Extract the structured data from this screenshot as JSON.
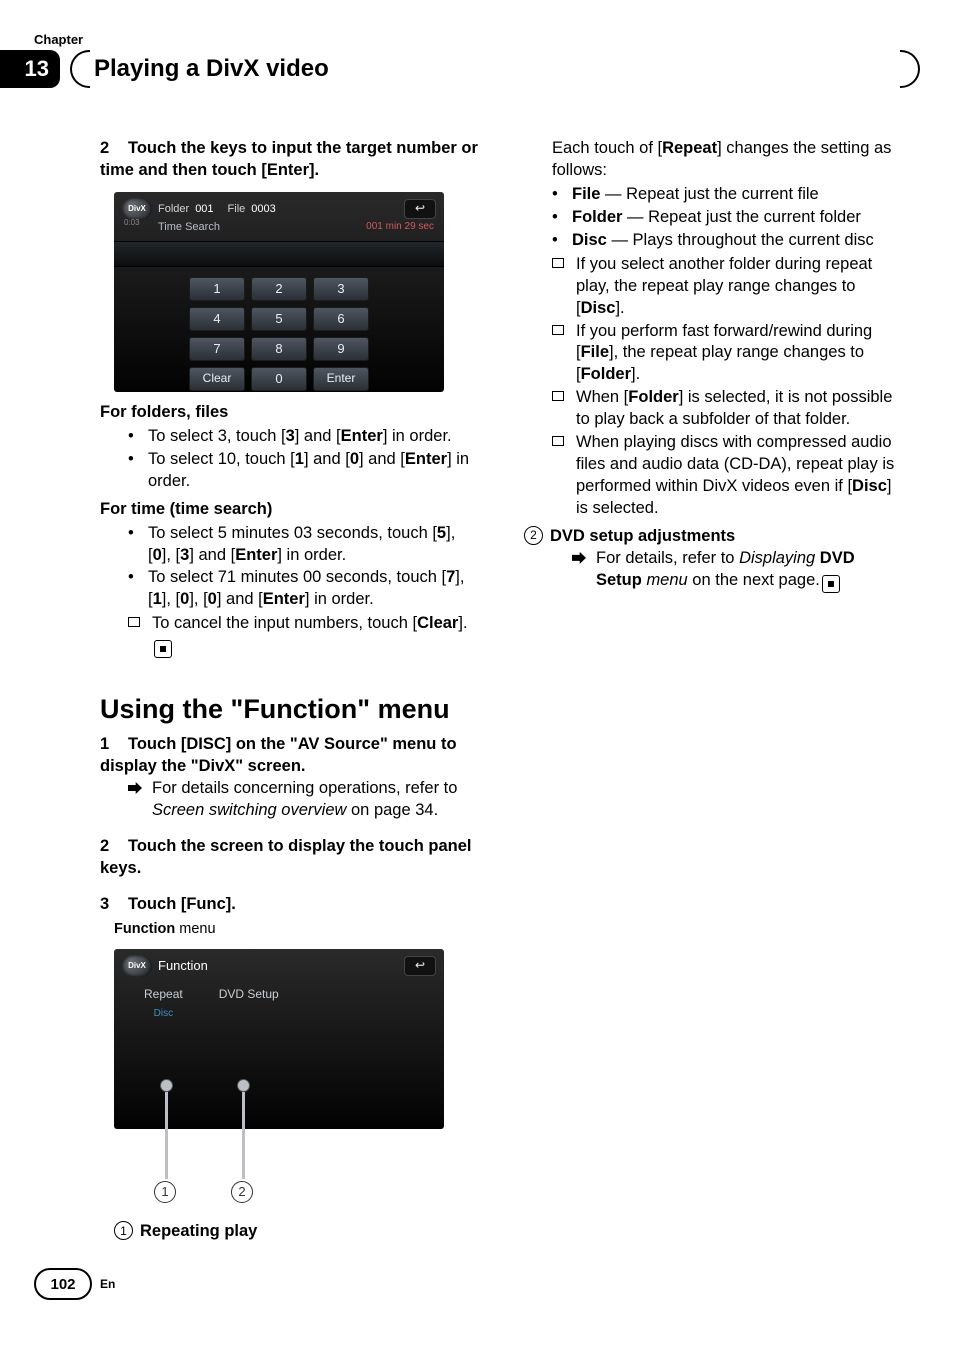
{
  "header": {
    "chapter_label": "Chapter",
    "chapter_number": "13",
    "title": "Playing a DivX video"
  },
  "footer": {
    "page_number": "102",
    "lang": "En"
  },
  "left": {
    "step2_num": "2",
    "step2_text": "Touch the keys to input the target number or time and then touch [Enter].",
    "shot1": {
      "logo": "DivX",
      "folder_lbl": "Folder",
      "folder_v": "001",
      "file_lbl": "File",
      "file_v": "0003",
      "sub_left": "Time Search",
      "sub_right": "001 min 29 sec",
      "time_tiny": "0:03",
      "keys": {
        "k1": "1",
        "k2": "2",
        "k3": "3",
        "k4": "4",
        "k5": "5",
        "k6": "6",
        "k7": "7",
        "k8": "8",
        "k9": "9",
        "clear": "Clear",
        "k0": "0",
        "enter": "Enter"
      }
    },
    "folders_head": "For folders, files",
    "folders_b1_a": "To select 3, touch [",
    "folders_b1_b": "3",
    "folders_b1_c": "] and [",
    "folders_b1_d": "Enter",
    "folders_b1_e": "] in order.",
    "folders_b2_a": "To select 10, touch [",
    "folders_b2_b": "1",
    "folders_b2_c": "] and [",
    "folders_b2_d": "0",
    "folders_b2_e": "] and [",
    "folders_b2_f": "Enter",
    "folders_b2_g": "] in order.",
    "time_head": "For time (time search)",
    "time_b1_a": "To select 5 minutes 03 seconds, touch [",
    "time_b1_b": "5",
    "time_b1_c": "], [",
    "time_b1_d": "0",
    "time_b1_e": "], [",
    "time_b1_f": "3",
    "time_b1_g": "] and [",
    "time_b1_h": "Enter",
    "time_b1_i": "] in order.",
    "time_b2_a": "To select 71 minutes 00 seconds, touch [",
    "time_b2_b": "7",
    "time_b2_c": "], [",
    "time_b2_d": "1",
    "time_b2_e": "], [",
    "time_b2_f": "0",
    "time_b2_g": "], [",
    "time_b2_h": "0",
    "time_b2_i": "] and [",
    "time_b2_j": "Enter",
    "time_b2_k": "] in order.",
    "time_sq_a": "To cancel the input numbers, touch [",
    "time_sq_b": "Clear",
    "time_sq_c": "].",
    "section_title_pre": "Using the \"",
    "section_title_mid": "Function",
    "section_title_post": "\" menu",
    "s1_num": "1",
    "s1_text": "Touch [DISC] on the \"AV Source\" menu to display the \"DivX\" screen.",
    "s1_arrow_a": "For details concerning operations, refer to ",
    "s1_arrow_b": "Screen switching overview",
    "s1_arrow_c": " on page 34.",
    "s2_num": "2",
    "s2_text": "Touch the screen to display the touch panel keys.",
    "s3_num": "3",
    "s3_text": "Touch [Func].",
    "func_caption_b": "Function",
    "func_caption_r": " menu",
    "shot2": {
      "logo": "DivX",
      "title": "Function",
      "item1": "Repeat",
      "item1_sub": "Disc",
      "item2": "DVD Setup"
    },
    "rep_num": "1",
    "rep_text": "Repeating play"
  },
  "right": {
    "intro_a": "Each touch of [",
    "intro_b": "Repeat",
    "intro_c": "] changes the setting as follows:",
    "b1_a": "File",
    "b1_b": " — Repeat just the current file",
    "b2_a": "Folder",
    "b2_b": " — Repeat just the current folder",
    "b3_a": "Disc",
    "b3_b": " — Plays throughout the current disc",
    "sq1_a": "If you select another folder during repeat play, the repeat play range changes to [",
    "sq1_b": "Disc",
    "sq1_c": "].",
    "sq2_a": "If you perform fast forward/rewind during [",
    "sq2_b": "File",
    "sq2_c": "], the repeat play range changes to [",
    "sq2_d": "Folder",
    "sq2_e": "].",
    "sq3_a": "When [",
    "sq3_b": "Folder",
    "sq3_c": "] is selected, it is not possible to play back a subfolder of that folder.",
    "sq4_a": "When playing discs with compressed audio files and audio data (CD-DA), repeat play is performed within DivX videos even if [",
    "sq4_b": "Disc",
    "sq4_c": "] is selected.",
    "dvd_num": "2",
    "dvd_head": "DVD setup adjustments",
    "dvd_arrow_a": "For details, refer to ",
    "dvd_arrow_b": "Displaying",
    "dvd_arrow_c": " ",
    "dvd_arrow_d": "DVD Setup",
    "dvd_arrow_e": " ",
    "dvd_arrow_f": "menu",
    "dvd_arrow_g": " on the next page."
  }
}
